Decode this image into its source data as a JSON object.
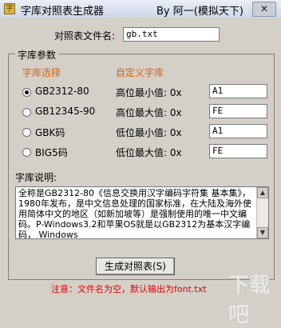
{
  "window": {
    "title": "字库对照表生成器",
    "author": "By 阿一(模拟天下)",
    "icon": "app-icon",
    "close_glyph": "✕"
  },
  "filename": {
    "label": "对照表文件名:",
    "value": "gb.txt"
  },
  "group": {
    "title": "字库参数"
  },
  "charset": {
    "heading": "字库选择",
    "options": [
      "GB2312-80",
      "GB12345-90",
      "GBK码",
      "BIG5码"
    ],
    "selected": "GB2312-80"
  },
  "custom": {
    "heading": "自定义字库",
    "high_min_label": "高位最小值: 0x",
    "high_min_value": "A1",
    "high_max_label": "高位最大值: 0x",
    "high_max_value": "FE",
    "low_min_label": "低位最小值: 0x",
    "low_min_value": "A1",
    "low_max_label": "低位最大值: 0x",
    "low_max_value": "FE"
  },
  "description": {
    "label": "字库说明:",
    "text": "全称是GB2312-80《信息交换用汉字编码字符集 基本集》，1980年发布，是中文信息处理的国家标准，在大陆及海外使用简体中文的地区（如新加坡等）是强制使用的唯一中文编码。P-Windows3.2和苹果OS就是以GB2312为基本汉字编码， Windows"
  },
  "generate_button": "生成对照表(S)",
  "note": "注意：文件名为空，默认输出为font.txt",
  "watermark": "下载吧",
  "colors": {
    "accent": "#e06000",
    "note": "#e00000",
    "background": "#d4d0c8"
  }
}
